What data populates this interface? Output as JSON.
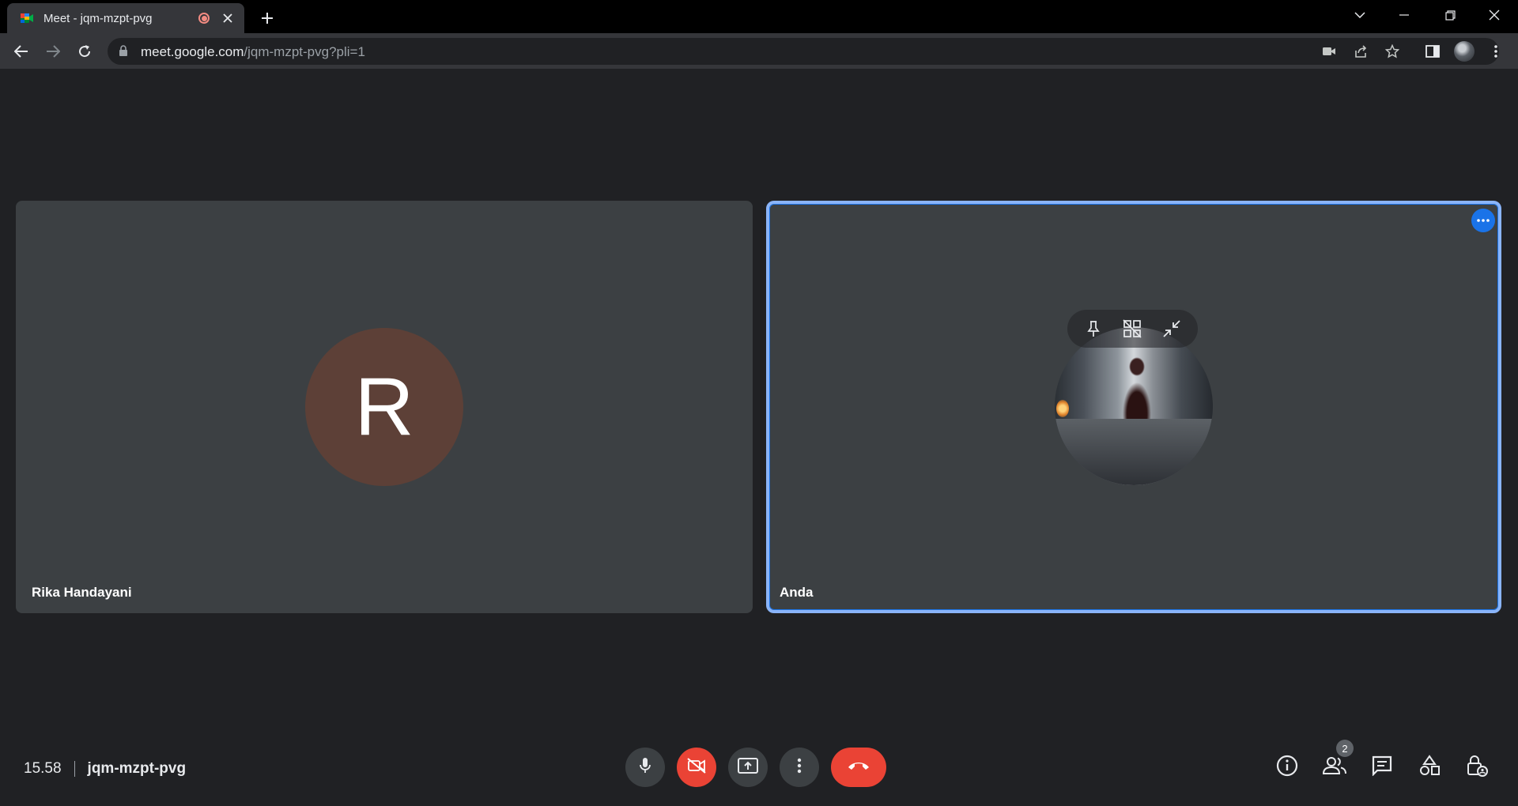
{
  "browser": {
    "tab_title": "Meet - jqm-mzpt-pvg",
    "url_host": "meet.google.com",
    "url_path": "/jqm-mzpt-pvg?pli=1"
  },
  "meeting": {
    "time": "15.58",
    "code": "jqm-mzpt-pvg",
    "participant_count": "2"
  },
  "participants": [
    {
      "name": "Rika Handayani",
      "initial": "R",
      "avatar_color": "#5d4037"
    },
    {
      "name": "Anda",
      "avatar": "profile-photo"
    }
  ],
  "colors": {
    "accent": "#1a73e8",
    "active_border": "#8ab4f8",
    "danger": "#ea4335",
    "tile_bg": "#3c4043",
    "page_bg": "#202124"
  },
  "icons": {
    "toolbar": [
      "back-icon",
      "forward-icon",
      "reload-icon",
      "lock-icon",
      "camera-icon",
      "share-icon",
      "star-icon",
      "side-panel-icon",
      "profile-avatar",
      "kebab-icon"
    ],
    "controls": [
      "mic-icon",
      "camera-off-icon",
      "present-screen-icon",
      "more-options-icon",
      "end-call-icon"
    ],
    "right": [
      "info-icon",
      "people-icon",
      "chat-icon",
      "activities-icon",
      "host-controls-icon"
    ],
    "tile_hover": [
      "pin-icon",
      "unpin-grid-icon",
      "minimize-icon"
    ]
  }
}
